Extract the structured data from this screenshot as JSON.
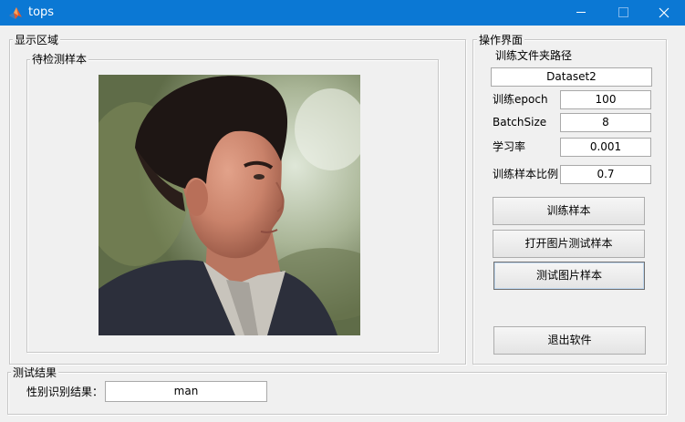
{
  "window": {
    "title": "tops",
    "title_bar_color": "#0b78d4"
  },
  "display_panel": {
    "title": "显示区域",
    "sample_group": {
      "title": "待检测样本"
    }
  },
  "operation_panel": {
    "title": "操作界面",
    "path_label": "训练文件夹路径",
    "path_value": "Dataset2",
    "params": [
      {
        "label": "训练epoch",
        "value": "100"
      },
      {
        "label": "BatchSize",
        "value": "8"
      },
      {
        "label": "学习率",
        "value": "0.001"
      },
      {
        "label": "训练样本比例",
        "value": "0.7"
      }
    ],
    "buttons": {
      "train": "训练样本",
      "open_test_image": "打开图片测试样本",
      "test_image": "测试图片样本",
      "exit": "退出软件"
    }
  },
  "result_panel": {
    "title": "测试结果",
    "gender_label": "性别识别结果：",
    "gender_value": "man"
  },
  "icons": [
    "matlab-icon",
    "minimize-icon",
    "maximize-icon",
    "close-icon"
  ]
}
